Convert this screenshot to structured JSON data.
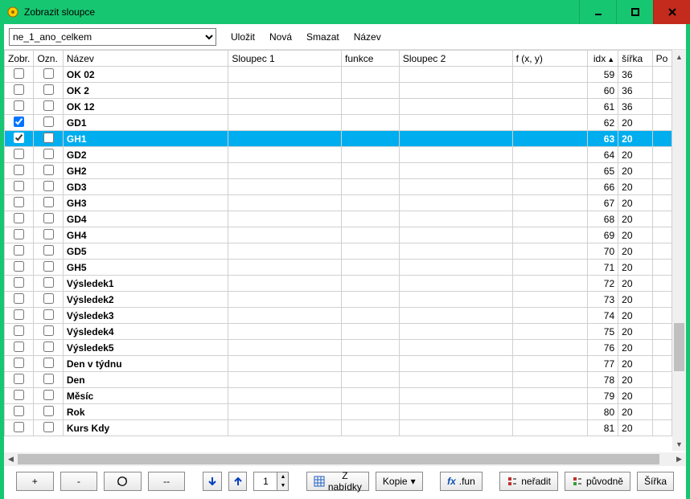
{
  "window": {
    "title": "Zobrazit sloupce"
  },
  "toolbar": {
    "selector_value": "ne_1_ano_celkem",
    "save": "Uložit",
    "new": "Nová",
    "delete": "Smazat",
    "name": "Název"
  },
  "columns": {
    "zobr": "Zobr.",
    "ozn": "Ozn.",
    "nazev": "Název",
    "sloupec1": "Sloupec 1",
    "funkce": "funkce",
    "sloupec2": "Sloupec 2",
    "fxy": "f (x, y)",
    "idx": "idx",
    "sirka": "šířka",
    "po": "Po"
  },
  "rows": [
    {
      "zobr": false,
      "ozn": false,
      "nazev": "OK 02",
      "idx": 59,
      "sirka": 36,
      "selected": false
    },
    {
      "zobr": false,
      "ozn": false,
      "nazev": "OK 2",
      "idx": 60,
      "sirka": 36,
      "selected": false
    },
    {
      "zobr": false,
      "ozn": false,
      "nazev": "OK 12",
      "idx": 61,
      "sirka": 36,
      "selected": false
    },
    {
      "zobr": true,
      "ozn": false,
      "nazev": "GD1",
      "idx": 62,
      "sirka": 20,
      "selected": false
    },
    {
      "zobr": true,
      "ozn": false,
      "nazev": "GH1",
      "idx": 63,
      "sirka": 20,
      "selected": true
    },
    {
      "zobr": false,
      "ozn": false,
      "nazev": "GD2",
      "idx": 64,
      "sirka": 20,
      "selected": false
    },
    {
      "zobr": false,
      "ozn": false,
      "nazev": "GH2",
      "idx": 65,
      "sirka": 20,
      "selected": false
    },
    {
      "zobr": false,
      "ozn": false,
      "nazev": "GD3",
      "idx": 66,
      "sirka": 20,
      "selected": false
    },
    {
      "zobr": false,
      "ozn": false,
      "nazev": "GH3",
      "idx": 67,
      "sirka": 20,
      "selected": false
    },
    {
      "zobr": false,
      "ozn": false,
      "nazev": "GD4",
      "idx": 68,
      "sirka": 20,
      "selected": false
    },
    {
      "zobr": false,
      "ozn": false,
      "nazev": "GH4",
      "idx": 69,
      "sirka": 20,
      "selected": false
    },
    {
      "zobr": false,
      "ozn": false,
      "nazev": "GD5",
      "idx": 70,
      "sirka": 20,
      "selected": false
    },
    {
      "zobr": false,
      "ozn": false,
      "nazev": "GH5",
      "idx": 71,
      "sirka": 20,
      "selected": false
    },
    {
      "zobr": false,
      "ozn": false,
      "nazev": "Výsledek1",
      "idx": 72,
      "sirka": 20,
      "selected": false
    },
    {
      "zobr": false,
      "ozn": false,
      "nazev": "Výsledek2",
      "idx": 73,
      "sirka": 20,
      "selected": false
    },
    {
      "zobr": false,
      "ozn": false,
      "nazev": "Výsledek3",
      "idx": 74,
      "sirka": 20,
      "selected": false
    },
    {
      "zobr": false,
      "ozn": false,
      "nazev": "Výsledek4",
      "idx": 75,
      "sirka": 20,
      "selected": false
    },
    {
      "zobr": false,
      "ozn": false,
      "nazev": "Výsledek5",
      "idx": 76,
      "sirka": 20,
      "selected": false
    },
    {
      "zobr": false,
      "ozn": false,
      "nazev": "Den v týdnu",
      "idx": 77,
      "sirka": 20,
      "selected": false
    },
    {
      "zobr": false,
      "ozn": false,
      "nazev": "Den",
      "idx": 78,
      "sirka": 20,
      "selected": false
    },
    {
      "zobr": false,
      "ozn": false,
      "nazev": "Měsíc",
      "idx": 79,
      "sirka": 20,
      "selected": false
    },
    {
      "zobr": false,
      "ozn": false,
      "nazev": "Rok",
      "idx": 80,
      "sirka": 20,
      "selected": false
    },
    {
      "zobr": false,
      "ozn": false,
      "nazev": "Kurs Kdy",
      "idx": 81,
      "sirka": 20,
      "selected": false
    }
  ],
  "bottom": {
    "plus": "+",
    "minus": "-",
    "double_minus": "--",
    "spin_value": "1",
    "from_menu": "Z nabídky",
    "copy": "Kopie",
    "fun": ".fun",
    "no_sort": "neřadit",
    "original": "původně",
    "width": "Šířka"
  }
}
